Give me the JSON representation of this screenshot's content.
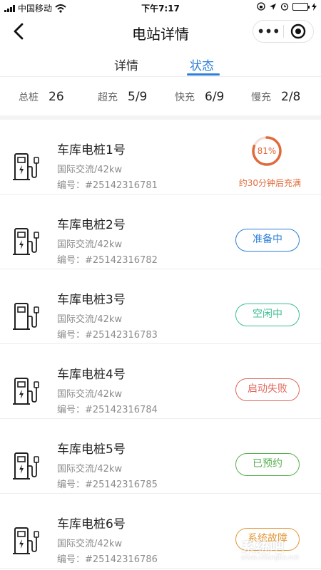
{
  "status_bar": {
    "carrier": "中国移动",
    "time": "下午7:17"
  },
  "nav": {
    "title": "电站详情",
    "more_label": "•••"
  },
  "tabs": [
    {
      "label": "详情",
      "active": false
    },
    {
      "label": "状态",
      "active": true
    }
  ],
  "summary": [
    {
      "label": "总桩",
      "value": "26"
    },
    {
      "label": "超充",
      "value": "5/9"
    },
    {
      "label": "快充",
      "value": "6/9"
    },
    {
      "label": "慢充",
      "value": "2/8"
    }
  ],
  "piles": [
    {
      "name": "车库电桩1号",
      "type": "国际交流/42kw",
      "code": "编号：#25142316781",
      "status_kind": "charging",
      "progress_percent": 81,
      "progress_label": "81%",
      "note": "约30分钟后充满",
      "color": "#e06a3a"
    },
    {
      "name": "车库电桩2号",
      "type": "国际交流/42kw",
      "code": "编号：#25142316782",
      "status_kind": "pill",
      "status": "准备中",
      "color": "#2d7fd8"
    },
    {
      "name": "车库电桩3号",
      "type": "国际交流/42kw",
      "code": "编号：#25142316783",
      "status_kind": "pill",
      "status": "空闲中",
      "color": "#3dbf8f"
    },
    {
      "name": "车库电桩4号",
      "type": "国际交流/42kw",
      "code": "编号：#25142316784",
      "status_kind": "pill",
      "status": "启动失败",
      "color": "#e0675c"
    },
    {
      "name": "车库电桩5号",
      "type": "国际交流/42kw",
      "code": "编号：#25142316785",
      "status_kind": "pill",
      "status": "已预约",
      "color": "#56b04c"
    },
    {
      "name": "车库电桩6号",
      "type": "国际交流/42kw",
      "code": "编号：#25142316786",
      "status_kind": "pill",
      "status": "系统故障",
      "color": "#e39a3a"
    }
  ],
  "watermark": {
    "text": "系统吧",
    "sub": "www.xitongba.net"
  }
}
